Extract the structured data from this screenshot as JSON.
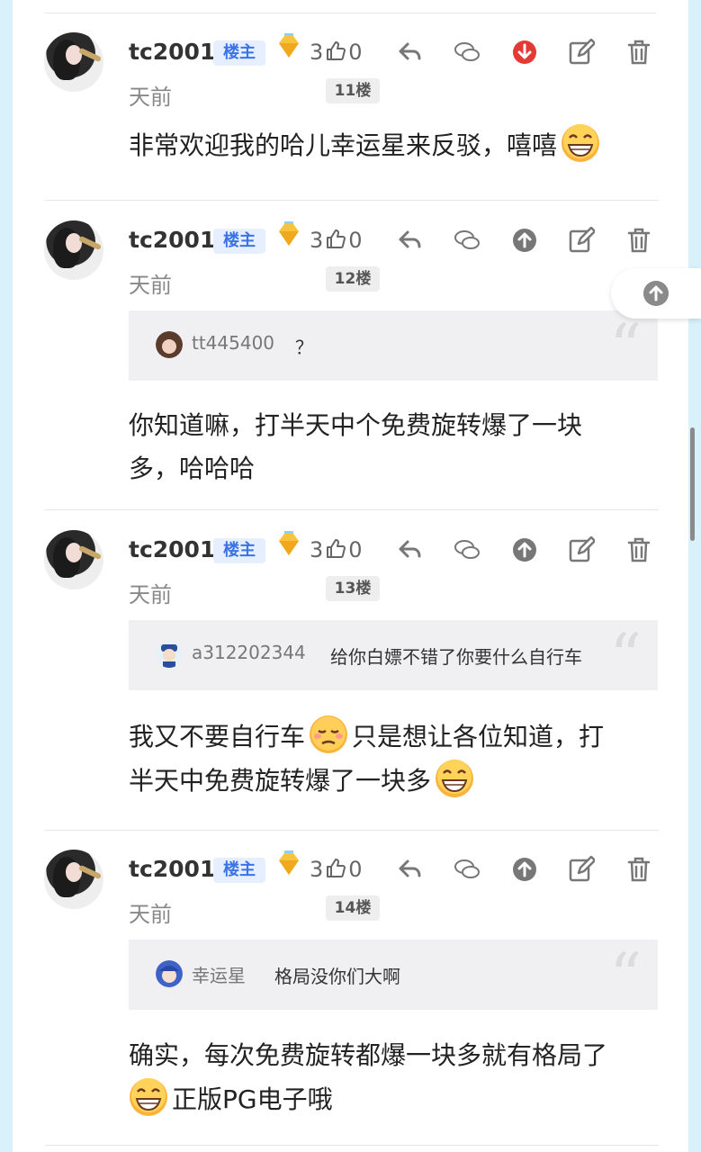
{
  "posts": [
    {
      "username": "tc2001",
      "owner_badge": "楼主",
      "likes_prefix": "3",
      "likes_count": "0",
      "time": "天前",
      "floor": "11楼",
      "vote_state": "down-red",
      "quote": null,
      "content_parts": [
        "非常欢迎我的哈儿幸运星来反驳，嘻嘻"
      ]
    },
    {
      "username": "tc2001",
      "owner_badge": "楼主",
      "likes_prefix": "3",
      "likes_count": "0",
      "time": "天前",
      "floor": "12楼",
      "vote_state": "up-gray",
      "quote": {
        "user": "tt445400",
        "text": "？"
      },
      "content_parts": [
        "你知道嘛，打半天中个免费旋转爆了一块",
        "多，哈哈哈"
      ]
    },
    {
      "username": "tc2001",
      "owner_badge": "楼主",
      "likes_prefix": "3",
      "likes_count": "0",
      "time": "天前",
      "floor": "13楼",
      "vote_state": "up-gray",
      "quote": {
        "user": "a312202344",
        "text": "给你白嫖不错了你要什么自行车"
      },
      "content_parts": [
        "我又不要自行车",
        "只是想让各位知道，打",
        "半天中免费旋转爆了一块多"
      ]
    },
    {
      "username": "tc2001",
      "owner_badge": "楼主",
      "likes_prefix": "3",
      "likes_count": "0",
      "time": "天前",
      "floor": "14楼",
      "vote_state": "up-gray",
      "quote": {
        "user": "幸运星",
        "text": "格局没你们大啊"
      },
      "content_parts": [
        "确实，每次免费旋转都爆一块多就有格局了",
        "正版PG电子哦"
      ]
    }
  ],
  "colors": {
    "owner_badge_bg": "#e6efff",
    "owner_badge_text": "#3b73e6",
    "downvote_active": "#e53935",
    "icon_gray": "#8a8a8a",
    "quote_bg": "#f0f0f2"
  },
  "icons": [
    "diamond-icon",
    "thumbs-up-icon",
    "reply-icon",
    "comment-icon",
    "vote-icon",
    "edit-icon",
    "delete-icon",
    "scroll-top-icon"
  ]
}
